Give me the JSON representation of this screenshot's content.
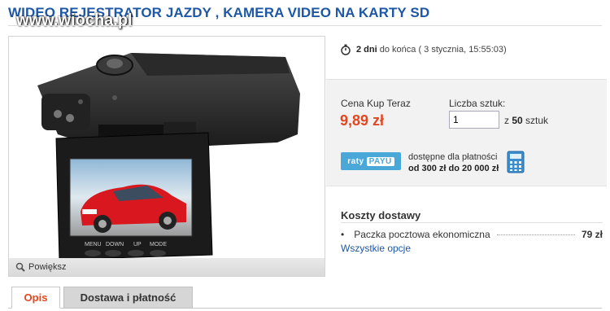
{
  "header": {
    "title": "WIDEO REJESTRATOR JAZDY , KAMERA VIDEO NA KARTY SD",
    "watermark": "www.wiocha.pl"
  },
  "image_panel": {
    "enlarge_label": "Powiększ",
    "screen_buttons": [
      "MENU",
      "DOWN",
      "UP",
      "MODE"
    ]
  },
  "auction_timer": {
    "remaining": "2 dni",
    "suffix": "do końca",
    "end_date": "( 3 stycznia, 15:55:03)"
  },
  "price_box": {
    "price_label": "Cena Kup Teraz",
    "price_value": "9,89 zł",
    "quantity_label": "Liczba sztuk:",
    "quantity_value": "1",
    "quantity_of_prefix": "z",
    "quantity_max": "50",
    "quantity_unit": "sztuk",
    "payu": {
      "logo_left": "raty",
      "logo_right": "PAYU",
      "line1": "dostępne dla płatności",
      "line2": "od 300 zł do 20 000 zł"
    }
  },
  "shipping": {
    "title": "Koszty dostawy",
    "items": [
      {
        "name": "Paczka pocztowa ekonomiczna",
        "price": "79 zł"
      }
    ],
    "all_options": "Wszystkie opcje"
  },
  "tabs": [
    {
      "label": "Opis",
      "active": true
    },
    {
      "label": "Dostawa i płatność",
      "active": false
    }
  ],
  "colors": {
    "title_blue": "#1d57a6",
    "price_orange": "#e4461f",
    "panel_gray": "#f2f2f2",
    "payu_blue": "#4aa8d8"
  }
}
